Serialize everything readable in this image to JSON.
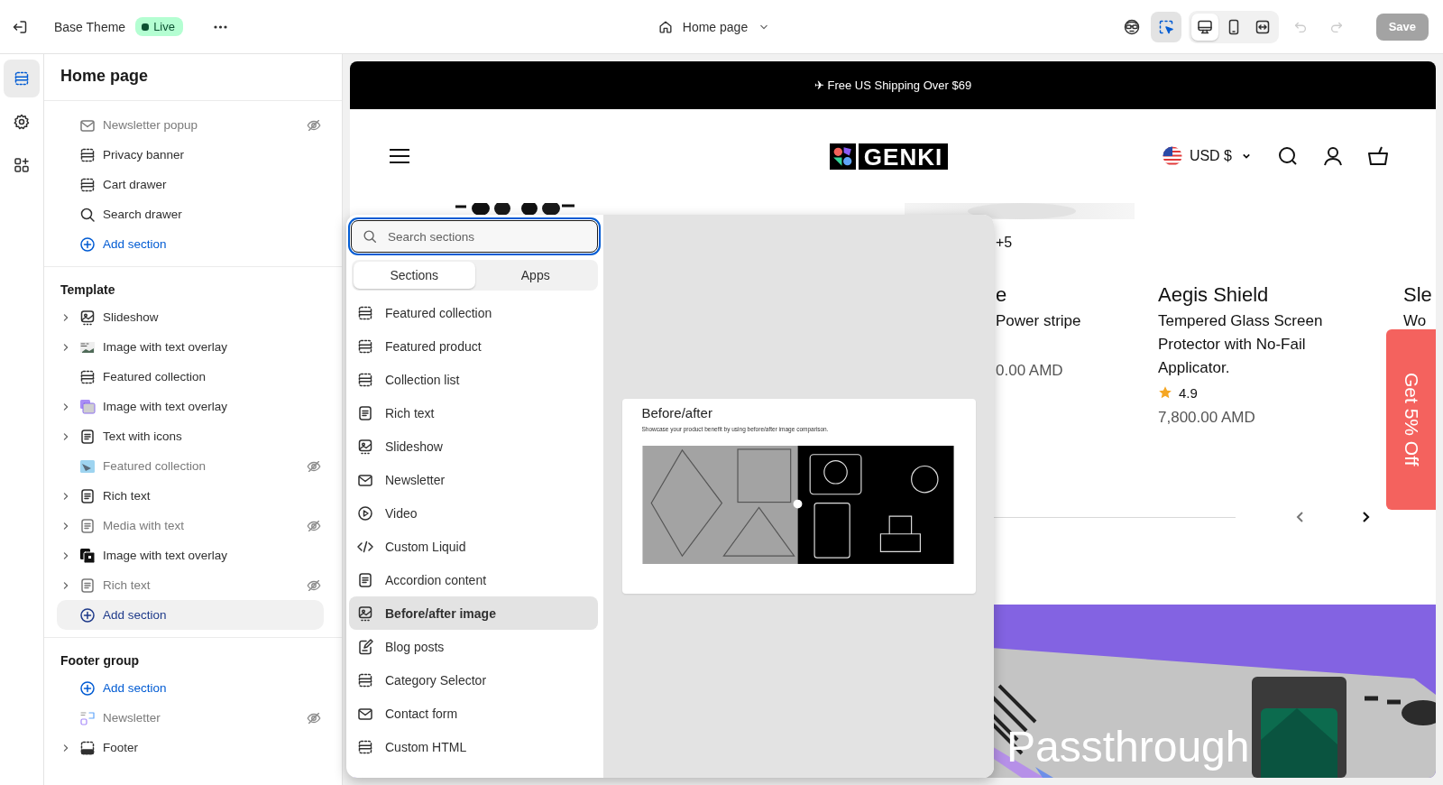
{
  "topbar": {
    "theme_name": "Base Theme",
    "status": "Live",
    "page_selector": "Home page",
    "tools": [
      {
        "kind": "preview",
        "selected": false
      },
      {
        "kind": "inspector",
        "selected": true
      }
    ],
    "devices": [
      {
        "kind": "desktop",
        "selected": true
      },
      {
        "kind": "mobile",
        "selected": false
      },
      {
        "kind": "fullwidth",
        "selected": false
      }
    ],
    "undo": {
      "disabled": true
    },
    "redo": {
      "disabled": true
    },
    "save": {
      "label": "Save",
      "disabled": true
    }
  },
  "rail": [
    {
      "kind": "sections",
      "selected": true
    },
    {
      "kind": "settings",
      "selected": false
    },
    {
      "kind": "apps",
      "selected": false
    }
  ],
  "sidebar": {
    "title": "Home page",
    "groups": [
      {
        "items": [
          {
            "kind": "envelope",
            "label": "Newsletter popup",
            "expandable": false,
            "hidden": true
          },
          {
            "kind": "dashed",
            "label": "Privacy banner",
            "expandable": false,
            "hidden": false
          },
          {
            "kind": "dashed",
            "label": "Cart drawer",
            "expandable": false,
            "hidden": false
          },
          {
            "kind": "search",
            "label": "Search drawer",
            "expandable": false,
            "hidden": false
          },
          {
            "kind": "add",
            "label": "Add section",
            "selected": false
          }
        ]
      },
      {
        "title": "Template",
        "items": [
          {
            "kind": "slideshow",
            "label": "Slideshow",
            "expandable": true,
            "hidden": false
          },
          {
            "kind": "thumb-gray",
            "label": "Image with text overlay",
            "expandable": true,
            "hidden": false
          },
          {
            "kind": "dashed",
            "label": "Featured collection",
            "expandable": false,
            "hidden": false
          },
          {
            "kind": "thumb-purple",
            "label": "Image with text overlay",
            "expandable": true,
            "hidden": false
          },
          {
            "kind": "text",
            "label": "Text with icons",
            "expandable": true,
            "hidden": false
          },
          {
            "kind": "thumb-blue",
            "label": "Featured collection",
            "expandable": false,
            "hidden": true
          },
          {
            "kind": "text",
            "label": "Rich text",
            "expandable": true,
            "hidden": false
          },
          {
            "kind": "text",
            "label": "Media with text",
            "expandable": true,
            "hidden": true
          },
          {
            "kind": "thumb-black",
            "label": "Image with text overlay",
            "expandable": true,
            "hidden": false
          },
          {
            "kind": "text",
            "label": "Rich text",
            "expandable": true,
            "hidden": true
          },
          {
            "kind": "add",
            "label": "Add section",
            "selected": true
          }
        ]
      },
      {
        "title": "Footer group",
        "items": [
          {
            "kind": "add",
            "label": "Add section",
            "selected": false
          },
          {
            "kind": "thumb-newsletter",
            "label": "Newsletter",
            "expandable": false,
            "hidden": true
          },
          {
            "kind": "footer",
            "label": "Footer",
            "expandable": true,
            "hidden": false
          }
        ]
      }
    ]
  },
  "store": {
    "announcement": "✈ Free US Shipping Over $69",
    "logo": "GENKI",
    "currency": "USD $",
    "products": [
      {
        "swatches": "+5",
        "title": "e",
        "description": "Power stripe",
        "price": "0.00 AMD"
      },
      {
        "title": "Aegis Shield",
        "description": "Tempered Glass Screen Protector with No-Fail Applicator.",
        "rating": "4.9",
        "price": "7,800.00 AMD"
      },
      {
        "title": "Sle",
        "description": "Wo"
      }
    ],
    "promo_tab": "Get 5% Off",
    "banner_heading": "Passthrough"
  },
  "picker": {
    "search": {
      "placeholder": "Search sections"
    },
    "tabs": [
      {
        "label": "Sections",
        "selected": true
      },
      {
        "label": "Apps",
        "selected": false
      }
    ],
    "items": [
      {
        "kind": "dashed",
        "label": "Featured collection",
        "selected": false
      },
      {
        "kind": "dashed",
        "label": "Featured product",
        "selected": false
      },
      {
        "kind": "dashed",
        "label": "Collection list",
        "selected": false
      },
      {
        "kind": "text",
        "label": "Rich text",
        "selected": false
      },
      {
        "kind": "slideshow",
        "label": "Slideshow",
        "selected": false
      },
      {
        "kind": "envelope",
        "label": "Newsletter",
        "selected": false
      },
      {
        "kind": "play",
        "label": "Video",
        "selected": false
      },
      {
        "kind": "code",
        "label": "Custom Liquid",
        "selected": false
      },
      {
        "kind": "text",
        "label": "Accordion content",
        "selected": false
      },
      {
        "kind": "slideshow",
        "label": "Before/after image",
        "selected": true
      },
      {
        "kind": "blog",
        "label": "Blog posts",
        "selected": false
      },
      {
        "kind": "dashed",
        "label": "Category Selector",
        "selected": false
      },
      {
        "kind": "envelope",
        "label": "Contact form",
        "selected": false
      },
      {
        "kind": "dashed",
        "label": "Custom HTML",
        "selected": false
      }
    ],
    "preview": {
      "title": "Before/after",
      "description": "Showcase your product benefit by using before/after image comparison."
    }
  }
}
